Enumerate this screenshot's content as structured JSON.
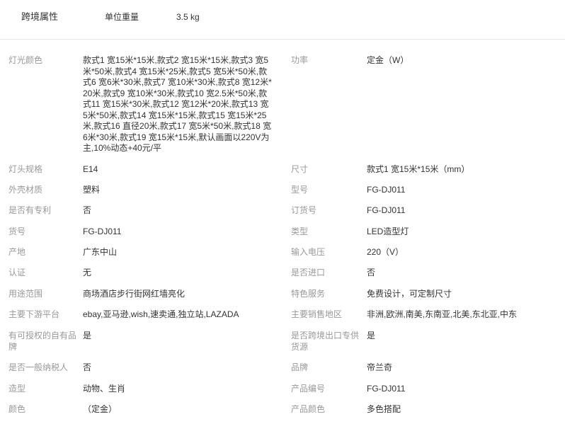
{
  "cross_border": {
    "title": "跨境属性",
    "weight_label": "单位重量",
    "weight_value": "3.5 kg"
  },
  "attributes": [
    {
      "left_key": "灯光颜色",
      "left_value": "款式1 宽15米*15米,款式2 宽15米*15米,款式3 宽5米*50米,款式4 宽15米*25米,款式5 宽5米*50米,款式6 宽6米*30米,款式7 宽10米*30米,款式8 宽12米*20米,款式9 宽10米*30米,款式10 宽2.5米*50米,款式11 宽15米*30米,款式12 宽12米*20米,款式13 宽5米*50米,款式14 宽15米*15米,款式15 宽15米*25米,款式16 直径20米,款式17 宽5米*50米,款式18 宽6米*30米,款式19 宽15米*15米,默认画面以220V为主,10%动态+40元/平",
      "right_key": "功率",
      "right_value": "定金（W）"
    },
    {
      "left_key": "灯头规格",
      "left_value": "E14",
      "right_key": "尺寸",
      "right_value": "款式1 宽15米*15米（mm）"
    },
    {
      "left_key": "外壳材质",
      "left_value": "塑料",
      "right_key": "型号",
      "right_value": "FG-DJ011"
    },
    {
      "left_key": "是否有专利",
      "left_value": "否",
      "right_key": "订货号",
      "right_value": "FG-DJ011"
    },
    {
      "left_key": "货号",
      "left_value": "FG-DJ011",
      "right_key": "类型",
      "right_value": "LED造型灯"
    },
    {
      "left_key": "产地",
      "left_value": "广东中山",
      "right_key": "输入电压",
      "right_value": "220（V）"
    },
    {
      "left_key": "认证",
      "left_value": "无",
      "right_key": "是否进口",
      "right_value": "否"
    },
    {
      "left_key": "用途范围",
      "left_value": "商场酒店步行街网红墙亮化",
      "right_key": "特色服务",
      "right_value": "免费设计，可定制尺寸"
    },
    {
      "left_key": "主要下游平台",
      "left_value": "ebay,亚马逊,wish,速卖通,独立站,LAZADA",
      "right_key": "主要销售地区",
      "right_value": "非洲,欧洲,南美,东南亚,北美,东北亚,中东"
    },
    {
      "left_key": "有可授权的自有品牌",
      "left_value": "是",
      "right_key": "是否跨境出口专供货源",
      "right_value": "是"
    },
    {
      "left_key": "是否一般纳税人",
      "left_value": "否",
      "right_key": "品牌",
      "right_value": "帝兰奇"
    },
    {
      "left_key": "造型",
      "left_value": "动物、生肖",
      "right_key": "产品编号",
      "right_value": "FG-DJ011"
    },
    {
      "left_key": "颜色",
      "left_value": "（定金）",
      "right_key": "产品颜色",
      "right_value": "多色搭配"
    }
  ]
}
